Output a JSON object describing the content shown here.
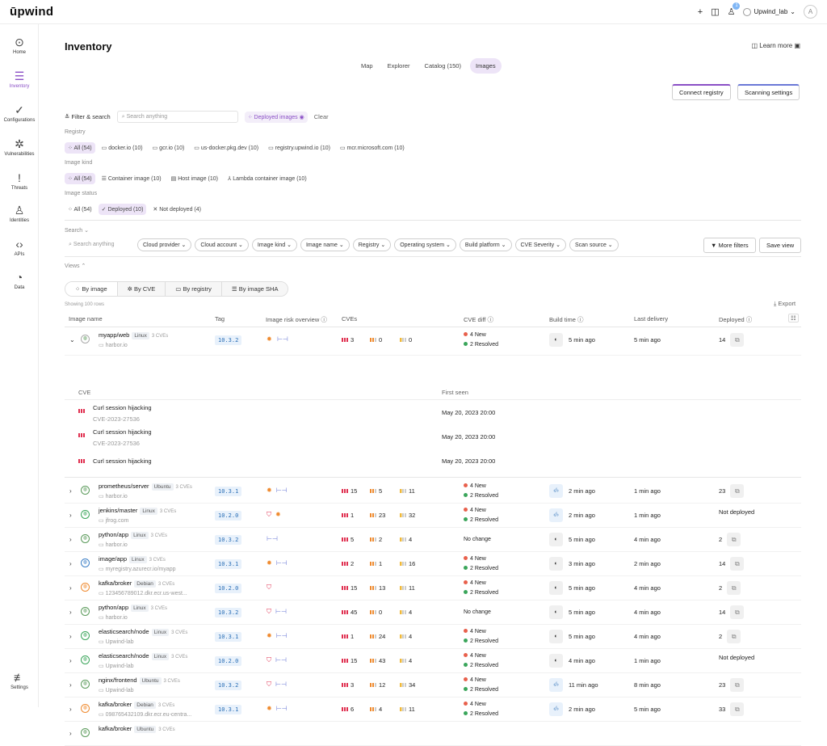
{
  "brand": "ūpwind",
  "topbar": {
    "notif_count": "1",
    "user": "Upwind_lab",
    "avatar": "A"
  },
  "sidebar": [
    {
      "label": "Home",
      "icon": "⊙"
    },
    {
      "label": "Inventory",
      "icon": "☰"
    },
    {
      "label": "Configurations",
      "icon": "✓"
    },
    {
      "label": "Vulnerabilities",
      "icon": "✲"
    },
    {
      "label": "Threats",
      "icon": "!"
    },
    {
      "label": "Identities",
      "icon": "♙"
    },
    {
      "label": "APIs",
      "icon": "‹›"
    },
    {
      "label": "Data",
      "icon": "◔"
    },
    {
      "label": "Settings",
      "icon": "≢"
    }
  ],
  "page": {
    "title": "Inventory",
    "learn_more": "Learn more"
  },
  "tabs": [
    {
      "label": "Map"
    },
    {
      "label": "Explorer"
    },
    {
      "label": "Catalog (150)"
    },
    {
      "label": "Images"
    }
  ],
  "buttons": {
    "connect": "Connect registry",
    "scanning": "Scanning settings",
    "more_filters": "More filters",
    "save_view": "Save view",
    "export": "Export"
  },
  "filterbar": {
    "filter_search": "Filter & search",
    "search_placeholder": "Search anything",
    "deployed_images": "Deployed images",
    "clear": "Clear"
  },
  "registry": {
    "label": "Registry",
    "chips": [
      "All (54)",
      "docker.io (10)",
      "gcr.io (10)",
      "us-docker.pkg.dev (10)",
      "registry.upwind.io (10)",
      "mcr.microsoft.com (10)"
    ]
  },
  "image_kind": {
    "label": "Image kind",
    "chips": [
      "All (54)",
      "Container image (10)",
      "Host image (10)",
      "Lambda container image (10)"
    ]
  },
  "image_status": {
    "label": "Image status",
    "chips": [
      "All (54)",
      "Deployed (10)",
      "Not deployed (4)"
    ]
  },
  "search_section": {
    "label": "Search",
    "placeholder": "Search anything",
    "pills": [
      "Cloud provider",
      "Cloud account",
      "Image kind",
      "Image name",
      "Registry",
      "Operating system",
      "Build platform",
      "CVE Severity",
      "Scan source"
    ]
  },
  "views": {
    "label": "Views",
    "tabs": [
      "By image",
      "By CVE",
      "By registry",
      "By image SHA"
    ],
    "showing": "Showing 100 rows"
  },
  "columns": {
    "name": "Image name",
    "tag": "Tag",
    "risk": "Image risk overview",
    "cves": "CVEs",
    "diff": "CVE diff",
    "build": "Build time",
    "delivery": "Last delivery",
    "deployed": "Deployed"
  },
  "expanded": {
    "name": "myapp/web",
    "os": "Linux",
    "cves": "3 CVEs",
    "reg": "harbor.io",
    "tag": "10.3.2",
    "c": "3",
    "h": "0",
    "m": "0",
    "new": "4 New",
    "resolved": "2 Resolved",
    "build": "5 min ago",
    "delivery": "5 min ago",
    "deployed": "14",
    "sub_cve": "CVE",
    "sub_first": "First seen",
    "sub": [
      {
        "title": "Curl session hijacking",
        "id": "CVE-2023-27536",
        "date": "May 20, 2023 20:00"
      },
      {
        "title": "Curl session hijacking",
        "id": "CVE-2023-27536",
        "date": "May 20, 2023 20:00"
      },
      {
        "title": "Curl session hijacking",
        "id": "",
        "date": "May 20, 2023 20:00"
      }
    ]
  },
  "rows": [
    {
      "name": "prometheus/server",
      "os": "Ubuntu",
      "cves": "3 CVEs",
      "reg": "harbor.io",
      "tag": "10.3.1",
      "c": "15",
      "h": "5",
      "m": "11",
      "new": "4 New",
      "resolved": "2 Resolved",
      "nochange": "",
      "build": "2 min ago",
      "delivery": "1 min ago",
      "deployed": "23"
    },
    {
      "name": "jenkins/master",
      "os": "Linux",
      "cves": "3 CVEs",
      "reg": "jfrog.com",
      "tag": "10.2.0",
      "c": "1",
      "h": "23",
      "m": "32",
      "new": "4 New",
      "resolved": "2 Resolved",
      "nochange": "",
      "build": "2 min ago",
      "delivery": "1 min ago",
      "deployed": "Not deployed"
    },
    {
      "name": "python/app",
      "os": "Linux",
      "cves": "3 CVEs",
      "reg": "harbor.io",
      "tag": "10.3.2",
      "c": "5",
      "h": "2",
      "m": "4",
      "new": "",
      "resolved": "",
      "nochange": "No change",
      "build": "5 min ago",
      "delivery": "4 min ago",
      "deployed": "2"
    },
    {
      "name": "image/app",
      "os": "Linux",
      "cves": "3 CVEs",
      "reg": "myregistry.azurecr.io/myapp",
      "tag": "10.3.1",
      "c": "2",
      "h": "1",
      "m": "16",
      "new": "4 New",
      "resolved": "2 Resolved",
      "nochange": "",
      "build": "3 min ago",
      "delivery": "2 min ago",
      "deployed": "14"
    },
    {
      "name": "kafka/broker",
      "os": "Debian",
      "cves": "3 CVEs",
      "reg": "123456789012.dkr.ecr.us-west...",
      "tag": "10.2.0",
      "c": "15",
      "h": "13",
      "m": "11",
      "new": "4 New",
      "resolved": "2 Resolved",
      "nochange": "",
      "build": "5 min ago",
      "delivery": "4 min ago",
      "deployed": "2"
    },
    {
      "name": "python/app",
      "os": "Linux",
      "cves": "3 CVEs",
      "reg": "harbor.io",
      "tag": "10.3.2",
      "c": "45",
      "h": "0",
      "m": "4",
      "new": "",
      "resolved": "",
      "nochange": "No change",
      "build": "5 min ago",
      "delivery": "4 min ago",
      "deployed": "14"
    },
    {
      "name": "elasticsearch/node",
      "os": "Linux",
      "cves": "3 CVEs",
      "reg": "Upwind-lab",
      "tag": "10.3.1",
      "c": "1",
      "h": "24",
      "m": "4",
      "new": "4 New",
      "resolved": "2 Resolved",
      "nochange": "",
      "build": "5 min ago",
      "delivery": "4 min ago",
      "deployed": "2"
    },
    {
      "name": "elasticsearch/node",
      "os": "Linux",
      "cves": "3 CVEs",
      "reg": "Upwind-lab",
      "tag": "10.2.0",
      "c": "15",
      "h": "43",
      "m": "4",
      "new": "4 New",
      "resolved": "2 Resolved",
      "nochange": "",
      "build": "4 min ago",
      "delivery": "1 min ago",
      "deployed": "Not deployed"
    },
    {
      "name": "nginx/frontend",
      "os": "Ubuntu",
      "cves": "3 CVEs",
      "reg": "Upwind-lab",
      "tag": "10.3.2",
      "c": "3",
      "h": "12",
      "m": "34",
      "new": "4 New",
      "resolved": "2 Resolved",
      "nochange": "",
      "build": "11  min ago",
      "delivery": "8 min ago",
      "deployed": "23"
    },
    {
      "name": "kafka/broker",
      "os": "Debian",
      "cves": "3 CVEs",
      "reg": "098765432109.dkr.ecr.eu-centra...",
      "tag": "10.3.1",
      "c": "6",
      "h": "4",
      "m": "11",
      "new": "4 New",
      "resolved": "2 Resolved",
      "nochange": "",
      "build": "2 min ago",
      "delivery": "5 min ago",
      "deployed": "33"
    },
    {
      "name": "kafka/broker",
      "os": "Ubuntu",
      "cves": "3 CVEs",
      "reg": "",
      "tag": "",
      "c": "",
      "h": "",
      "m": "",
      "new": "",
      "resolved": "",
      "nochange": "",
      "build": "",
      "delivery": "",
      "deployed": ""
    }
  ]
}
